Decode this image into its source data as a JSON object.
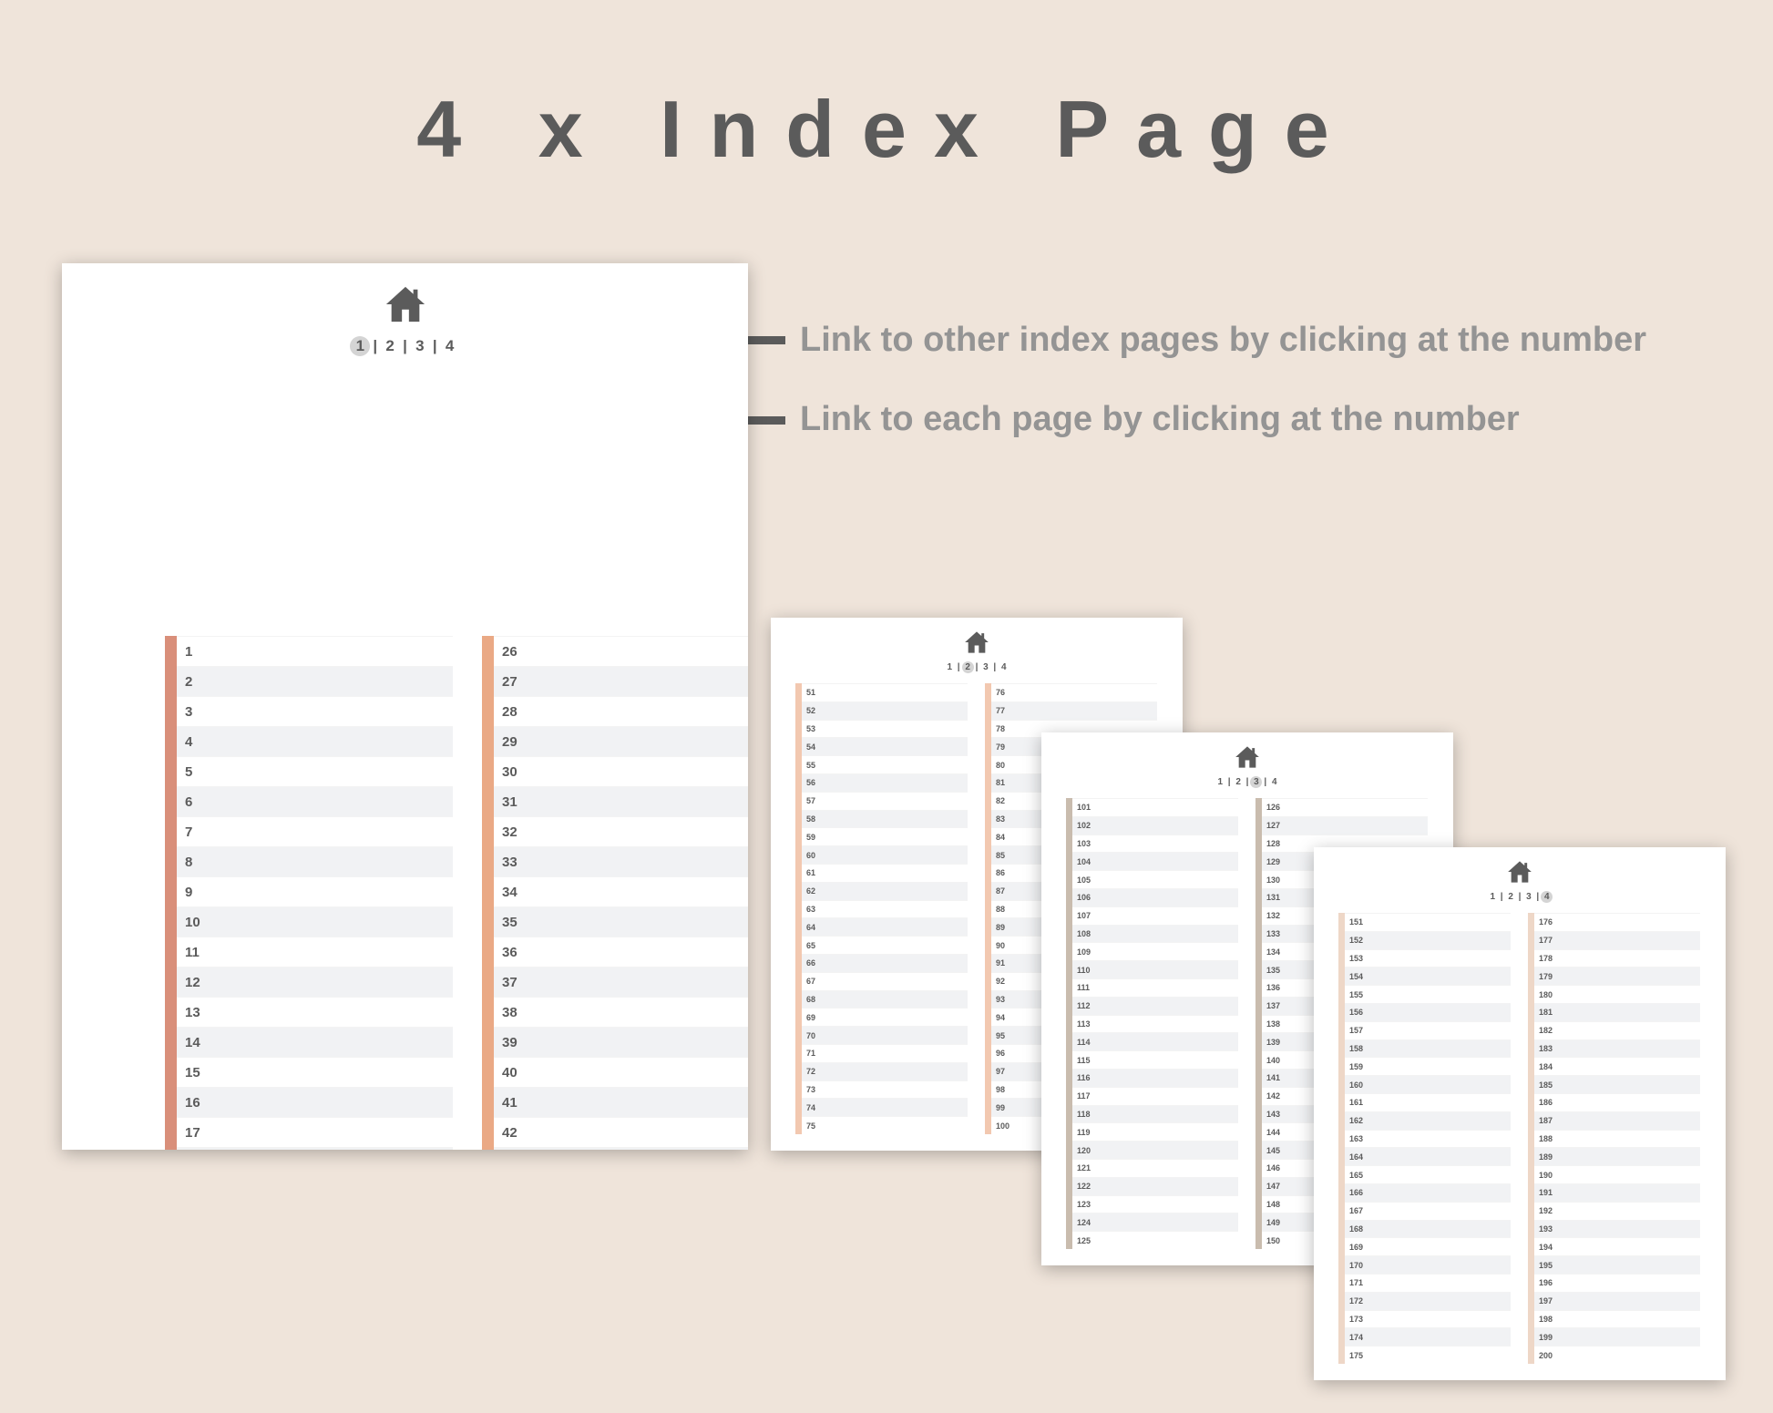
{
  "title": "4 x Index Page",
  "callouts": [
    {
      "text": "Link to other index pages by clicking at the number"
    },
    {
      "text": "Link to each page by clicking at the number"
    }
  ],
  "nav": {
    "items": [
      "1",
      "2",
      "3",
      "4"
    ],
    "separator": "|"
  },
  "colors": {
    "page1_left_bar": "#d98f7a",
    "page1_right_bar": "#eaa985",
    "page2_bar": "#f2c8b0",
    "page3_bar": "#c9bcae",
    "page4_bar": "#eed7c7",
    "icon": "#5b5b5b"
  },
  "pages": [
    {
      "active": 1,
      "start": 1
    },
    {
      "active": 2,
      "start": 51
    },
    {
      "active": 3,
      "start": 101
    },
    {
      "active": 4,
      "start": 151
    }
  ]
}
